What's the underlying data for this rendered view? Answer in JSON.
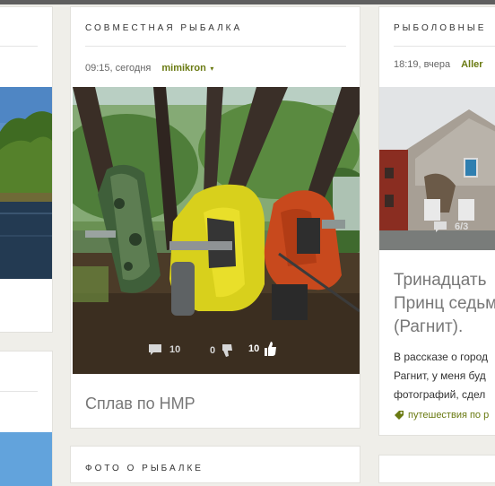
{
  "center_card": {
    "title": "Совместная рыбалка",
    "time": "09:15, сегодня",
    "author": "mimikron",
    "author_caret": "▾",
    "comments": "10",
    "dislikes": "0",
    "likes": "10",
    "post_title": "Сплав по НМР"
  },
  "right_card": {
    "title": "Рыболовные",
    "time": "18:19, вчера",
    "author": "Aller",
    "photo_counter": "6/3",
    "post_title_lines": [
      "Тринадцать",
      "Принц седьм",
      "(Рагнит)."
    ],
    "excerpt_lines": [
      "В рассказе о город",
      "Рагнит, у меня буд",
      "фотографий, сдел"
    ],
    "tag": "путешествия по р"
  },
  "bottom_center_card": {
    "title": "Фото о рыбалке"
  },
  "colors": {
    "author": "#6a7a12",
    "background": "#efeee9",
    "stats": "#d7d7d7"
  }
}
